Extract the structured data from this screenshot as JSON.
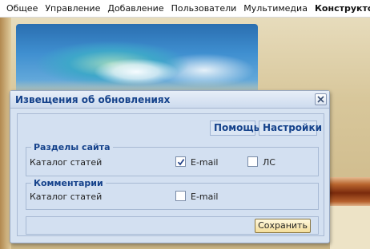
{
  "menu": {
    "items": [
      "Общее",
      "Управление",
      "Добавление",
      "Пользователи",
      "Мультимедиа",
      "Конструктор",
      "?"
    ],
    "active_index": 5
  },
  "dialog": {
    "title": "Извещения об обновлениях",
    "toolbar": {
      "help_label": "Помощь",
      "settings_label": "Настройки"
    },
    "sections": {
      "legend": "Разделы сайта",
      "row_label": "Каталог статей",
      "email_label": "E-mail",
      "email_checked": true,
      "pm_label": "ЛС",
      "pm_checked": false
    },
    "comments": {
      "legend": "Комментарии",
      "row_label": "Каталог статей",
      "email_label": "E-mail",
      "email_checked": false
    },
    "save_label": "Сохранить"
  },
  "colors": {
    "title_text": "#15428b",
    "dialog_bg": "#d6e2f1",
    "menu_bg": "#ffffff"
  }
}
